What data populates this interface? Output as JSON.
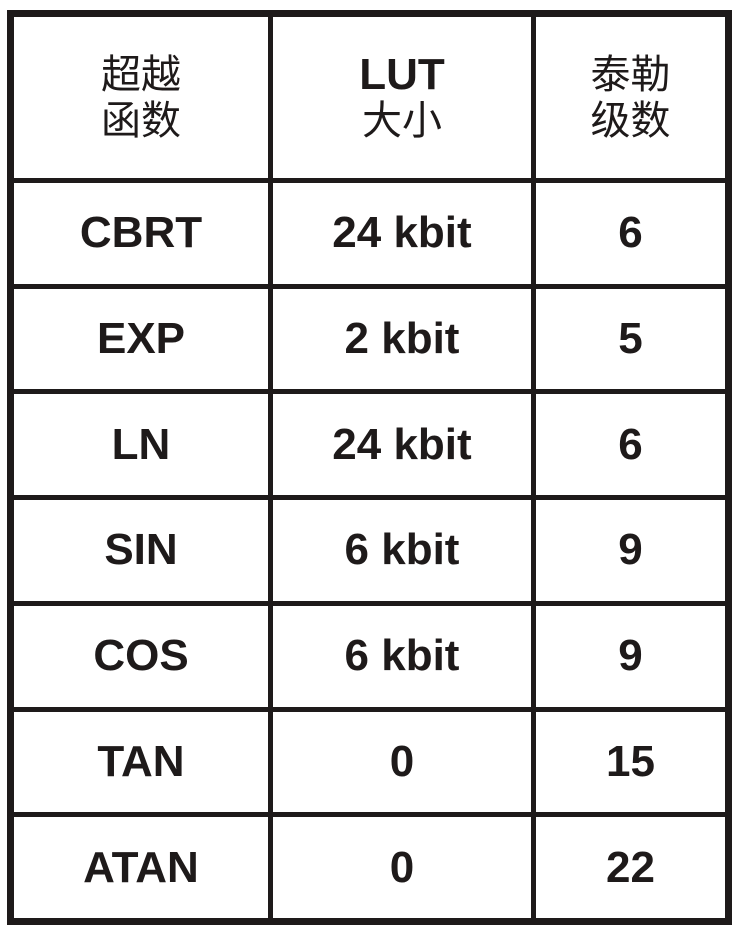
{
  "table": {
    "headers": [
      {
        "lines": [
          "超越",
          "函数"
        ]
      },
      {
        "lines": [
          "LUT",
          "大小"
        ]
      },
      {
        "lines": [
          "泰勒",
          "级数"
        ]
      }
    ],
    "rows": [
      [
        "CBRT",
        "24 kbit",
        "6"
      ],
      [
        "EXP",
        "2 kbit",
        "5"
      ],
      [
        "LN",
        "24 kbit",
        "6"
      ],
      [
        "SIN",
        "6 kbit",
        "9"
      ],
      [
        "COS",
        "6 kbit",
        "9"
      ],
      [
        "TAN",
        "0",
        "15"
      ],
      [
        "ATAN",
        "0",
        "22"
      ]
    ]
  }
}
